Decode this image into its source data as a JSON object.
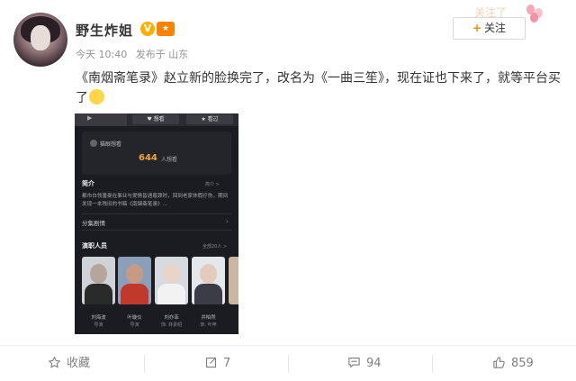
{
  "author": {
    "name": "野生炸姐",
    "verified_badge": "V",
    "member_badge": "会员"
  },
  "post_meta": {
    "time": "今天 10:40",
    "location": "发布于 山东"
  },
  "follow_button": {
    "label": "关注",
    "plus": "+"
  },
  "decoration_text": "关注了",
  "post_text": "《南烟斋笔录》赵立新的脸换完了，改名为《一曲三笙》，现在证也下来了，就等平台买了",
  "embedded_screenshot": {
    "top_buttons": [
      "♥ 想看",
      "★ 看过"
    ],
    "rating_card_label": "猫眼想看",
    "want_count": "644",
    "want_unit": "人想看",
    "synopsis_title": "简介",
    "synopsis_more": "简介 >",
    "synopsis_text": "都市白领唐曼在事业与爱情皆遇瓶颈时，回到老家休假疗伤，期间发现一本残旧的书稿《南烟斋笔录》...",
    "episodes_label": "分集剧情",
    "cast_title": "演职人员",
    "cast_more": "全部20人 >",
    "cast": [
      {
        "name": "刘海波",
        "role": "导演"
      },
      {
        "name": "叶璇仪",
        "role": "导演"
      },
      {
        "name": "刘亦菲",
        "role": "饰: 林素昭"
      },
      {
        "name": "井柏然",
        "role": "饰: 叶申"
      },
      {
        "name": "",
        "role": ""
      }
    ]
  },
  "footer": {
    "favorite_label": "收藏",
    "repost_count": "7",
    "comment_count": "94",
    "like_count": "859"
  },
  "colors": {
    "accent_orange": "#ff8200",
    "text_main": "#333333",
    "text_meta": "#939393",
    "want_count_color": "#f3a33c",
    "screenshot_bg": "#1b1c21"
  }
}
